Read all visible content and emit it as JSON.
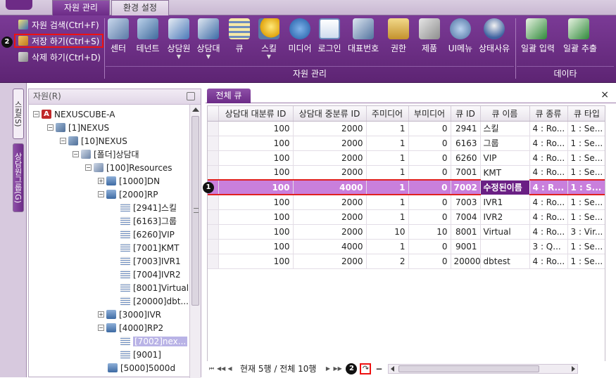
{
  "tabs": [
    {
      "label": "자원 관리",
      "active": true
    },
    {
      "label": "환경 설정",
      "active": false
    }
  ],
  "ribbon": {
    "commands": {
      "search": "자원 검색(Ctrl+F)",
      "save": "저장 하기(Ctrl+S)",
      "delete": "삭제 하기(Ctrl+D)"
    },
    "buttons": [
      {
        "label": "센터",
        "icon": "building-icon"
      },
      {
        "label": "테넌트",
        "icon": "cube-icon"
      },
      {
        "label": "상담원",
        "icon": "agent-pc-icon",
        "dropdown": true
      },
      {
        "label": "상담대",
        "icon": "agent-desk-icon",
        "dropdown": true
      },
      {
        "label": "큐",
        "icon": "queue-icon"
      },
      {
        "label": "스킬",
        "icon": "skill-bulb-icon",
        "dropdown": true
      },
      {
        "label": "미디어",
        "icon": "media-phone-icon"
      },
      {
        "label": "로그인",
        "icon": "login-id-icon"
      },
      {
        "label": "대표번호",
        "icon": "rep-number-icon"
      },
      {
        "label": "권한",
        "icon": "lock-icon"
      },
      {
        "label": "제품",
        "icon": "box-icon"
      },
      {
        "label": "UI메뉴",
        "icon": "ui-menu-icon"
      },
      {
        "label": "상태사유",
        "icon": "status-reason-icon"
      },
      {
        "label": "일괄 입력",
        "icon": "excel-import-icon"
      },
      {
        "label": "일괄 추출",
        "icon": "excel-export-icon"
      }
    ],
    "groups": {
      "resource": "자원 관리",
      "data": "데이타"
    }
  },
  "side_tabs": {
    "skill": "스킬(S)",
    "agent_group": "상담원그룹(G)"
  },
  "tree": {
    "title": "자원(R)",
    "nodes": [
      {
        "label": "NEXUSCUBE-A",
        "expanded": true
      },
      {
        "label": "[1]NEXUS",
        "expanded": true
      },
      {
        "label": "[10]NEXUS",
        "expanded": true
      },
      {
        "label": "[폴더]상담대",
        "expanded": true
      },
      {
        "label": "[100]Resources",
        "expanded": true
      },
      {
        "label": "[1000]DN",
        "expanded": false
      },
      {
        "label": "[2000]RP",
        "expanded": true
      },
      {
        "label": "[2941]스킬"
      },
      {
        "label": "[6163]그룹"
      },
      {
        "label": "[6260]VIP"
      },
      {
        "label": "[7001]KMT"
      },
      {
        "label": "[7003]IVR1"
      },
      {
        "label": "[7004]IVR2"
      },
      {
        "label": "[8001]Virtual"
      },
      {
        "label": "[20000]dbt..."
      },
      {
        "label": "[3000]IVR",
        "expanded": false
      },
      {
        "label": "[4000]RP2",
        "expanded": true
      },
      {
        "label": "[7002]nex...",
        "selected": true
      },
      {
        "label": "[9001]"
      },
      {
        "label": "[5000]5000d"
      }
    ]
  },
  "queue": {
    "tab_label": "전체 큐",
    "close_icon": "×",
    "columns": [
      "상담대 대분류 ID",
      "상담대 중분류 ID",
      "주미디어",
      "부미디어",
      "큐 ID",
      "큐 이름",
      "큐 종류",
      "큐 타입"
    ],
    "rows": [
      [
        "100",
        "2000",
        "1",
        "0",
        "2941",
        "스킬",
        "4 : Ro...",
        "1 : Se..."
      ],
      [
        "100",
        "2000",
        "1",
        "0",
        "6163",
        "그룹",
        "4 : Ro...",
        "1 : Se..."
      ],
      [
        "100",
        "2000",
        "1",
        "0",
        "6260",
        "VIP",
        "4 : Ro...",
        "1 : Se..."
      ],
      [
        "100",
        "2000",
        "1",
        "0",
        "7001",
        "KMT",
        "4 : Ro...",
        "1 : Se..."
      ],
      [
        "100",
        "4000",
        "1",
        "0",
        "7002",
        "수정된이름",
        "4 : R...",
        "1 : S..."
      ],
      [
        "100",
        "2000",
        "1",
        "0",
        "7003",
        "IVR1",
        "4 : Ro...",
        "1 : Se..."
      ],
      [
        "100",
        "2000",
        "1",
        "0",
        "7004",
        "IVR2",
        "4 : Ro...",
        "1 : Se..."
      ],
      [
        "100",
        "2000",
        "10",
        "10",
        "8001",
        "Virtual",
        "4 : Ro...",
        "3 : Vir..."
      ],
      [
        "100",
        "4000",
        "1",
        "0",
        "9001",
        "",
        "3 : Q...",
        "1 : Se..."
      ],
      [
        "100",
        "2000",
        "2",
        "0",
        "20000",
        "dbtest",
        "4 : Ro...",
        "1 : Se..."
      ]
    ],
    "selected_row": 4,
    "status": "현재 5행 / 전체 10행"
  },
  "markers": [
    "1",
    "2",
    "2"
  ],
  "colors": {
    "accent": "#6c2b87",
    "highlight": "#e11111",
    "selected_row": "#c97fdc"
  }
}
